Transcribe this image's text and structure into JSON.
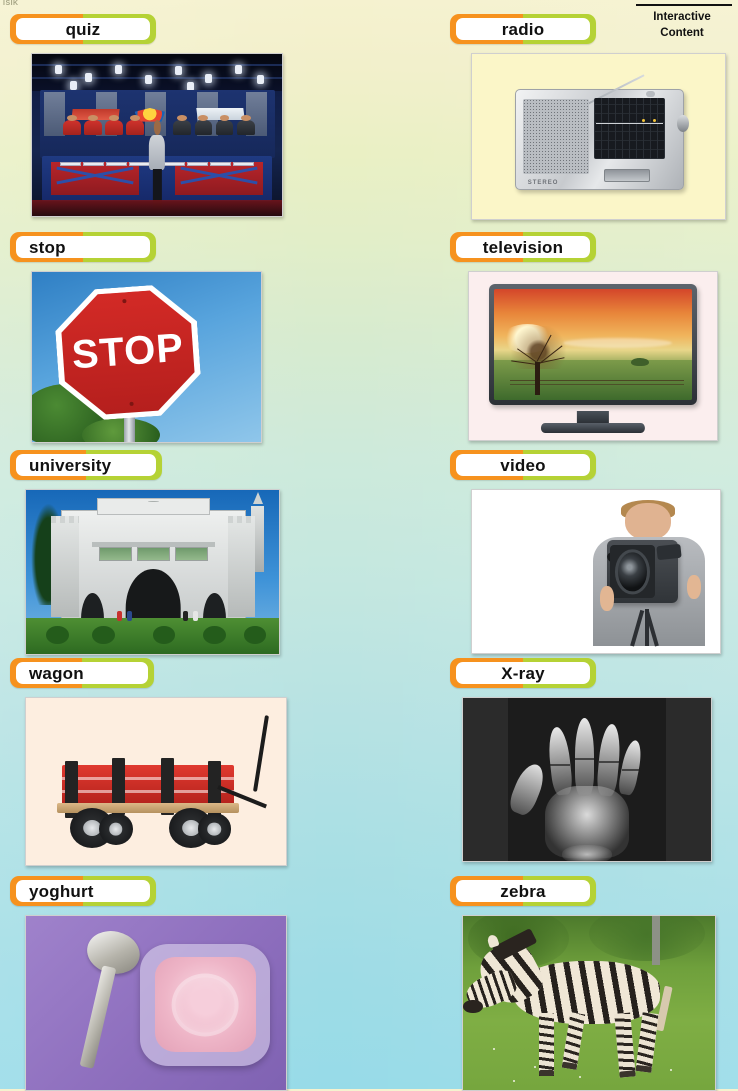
{
  "page": {
    "corner_crumb": "ISIK",
    "section_title_line1": "Interactive",
    "section_title_line2": "Content",
    "accent_orange": "#f6921e",
    "accent_green": "#b5d235",
    "background_top": "#f5f2cf",
    "background_bottom": "#97dbe8"
  },
  "cards": [
    {
      "word": "quiz",
      "align": "center",
      "image_name": "quiz-tv-studio-photo",
      "image_alt": "TV quiz show studio with two teams of contestants and a host",
      "frame_bg": "#0c1430"
    },
    {
      "word": "radio",
      "align": "center",
      "image_name": "radio-portable-receiver-photo",
      "image_alt": "Silver portable multi-band stereo radio with extended antenna",
      "frame_bg": "#fbf6c8"
    },
    {
      "word": "stop",
      "align": "lead",
      "image_name": "stop-sign-photo",
      "image_alt": "Red octagonal STOP sign against a blue sky",
      "sign_text": "STOP",
      "frame_bg": "#58a4dd"
    },
    {
      "word": "television",
      "align": "center",
      "image_name": "television-flatscreen-photo",
      "image_alt": "Flat screen television showing a sunset countryside landscape",
      "frame_bg": "#fbeeee"
    },
    {
      "word": "university",
      "align": "lead",
      "image_name": "university-gate-photo",
      "image_alt": "Historic stone university main gate building under a blue sky",
      "frame_bg": "#3f93d8"
    },
    {
      "word": "video",
      "align": "center",
      "image_name": "video-camera-operator-photo",
      "image_alt": "Man filming with a professional video camera on a white background",
      "frame_bg": "#ffffff"
    },
    {
      "word": "wagon",
      "align": "lead",
      "image_name": "wagon-red-cart-photo",
      "image_alt": "Red wooden pull wagon with four rubber wheels",
      "frame_bg": "#fdeee0"
    },
    {
      "word": "X-ray",
      "align": "center",
      "image_name": "xray-hand-photo",
      "image_alt": "X-ray radiograph of a human hand",
      "frame_bg": "#2b2b2b"
    },
    {
      "word": "yoghurt",
      "align": "lead",
      "image_name": "yoghurt-pot-photo",
      "image_alt": "Pot of pink strawberry yoghurt with a silver spoon on a purple surface",
      "frame_bg": "#8e6fbe"
    },
    {
      "word": "zebra",
      "align": "center",
      "image_name": "zebra-walking-photo",
      "image_alt": "Zebra walking across green grass",
      "frame_bg": "#6fa03c"
    }
  ]
}
